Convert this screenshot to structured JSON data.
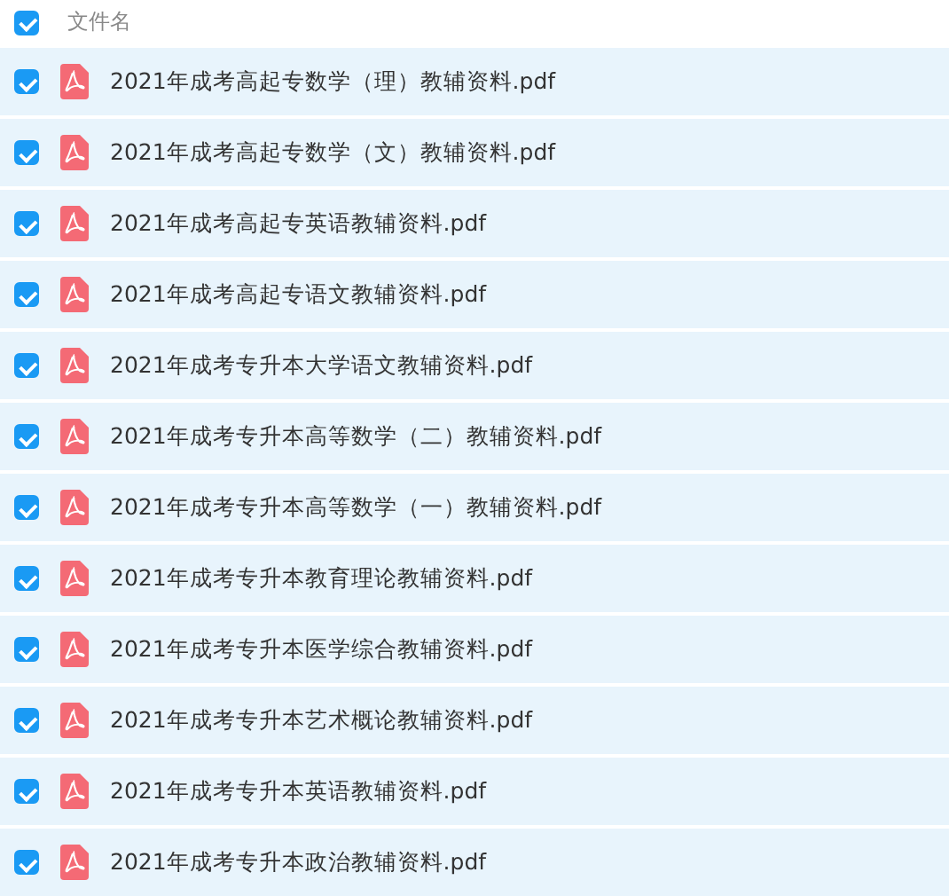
{
  "header": {
    "checked": true,
    "label": "文件名"
  },
  "files": [
    {
      "name": "2021年成考高起专数学（理）教辅资料.pdf",
      "checked": true
    },
    {
      "name": "2021年成考高起专数学（文）教辅资料.pdf",
      "checked": true
    },
    {
      "name": "2021年成考高起专英语教辅资料.pdf",
      "checked": true
    },
    {
      "name": "2021年成考高起专语文教辅资料.pdf",
      "checked": true
    },
    {
      "name": "2021年成考专升本大学语文教辅资料.pdf",
      "checked": true
    },
    {
      "name": "2021年成考专升本高等数学（二）教辅资料.pdf",
      "checked": true
    },
    {
      "name": "2021年成考专升本高等数学（一）教辅资料.pdf",
      "checked": true
    },
    {
      "name": "2021年成考专升本教育理论教辅资料.pdf",
      "checked": true
    },
    {
      "name": "2021年成考专升本医学综合教辅资料.pdf",
      "checked": true
    },
    {
      "name": "2021年成考专升本艺术概论教辅资料.pdf",
      "checked": true
    },
    {
      "name": "2021年成考专升本英语教辅资料.pdf",
      "checked": true
    },
    {
      "name": "2021年成考专升本政治教辅资料.pdf",
      "checked": true
    }
  ]
}
